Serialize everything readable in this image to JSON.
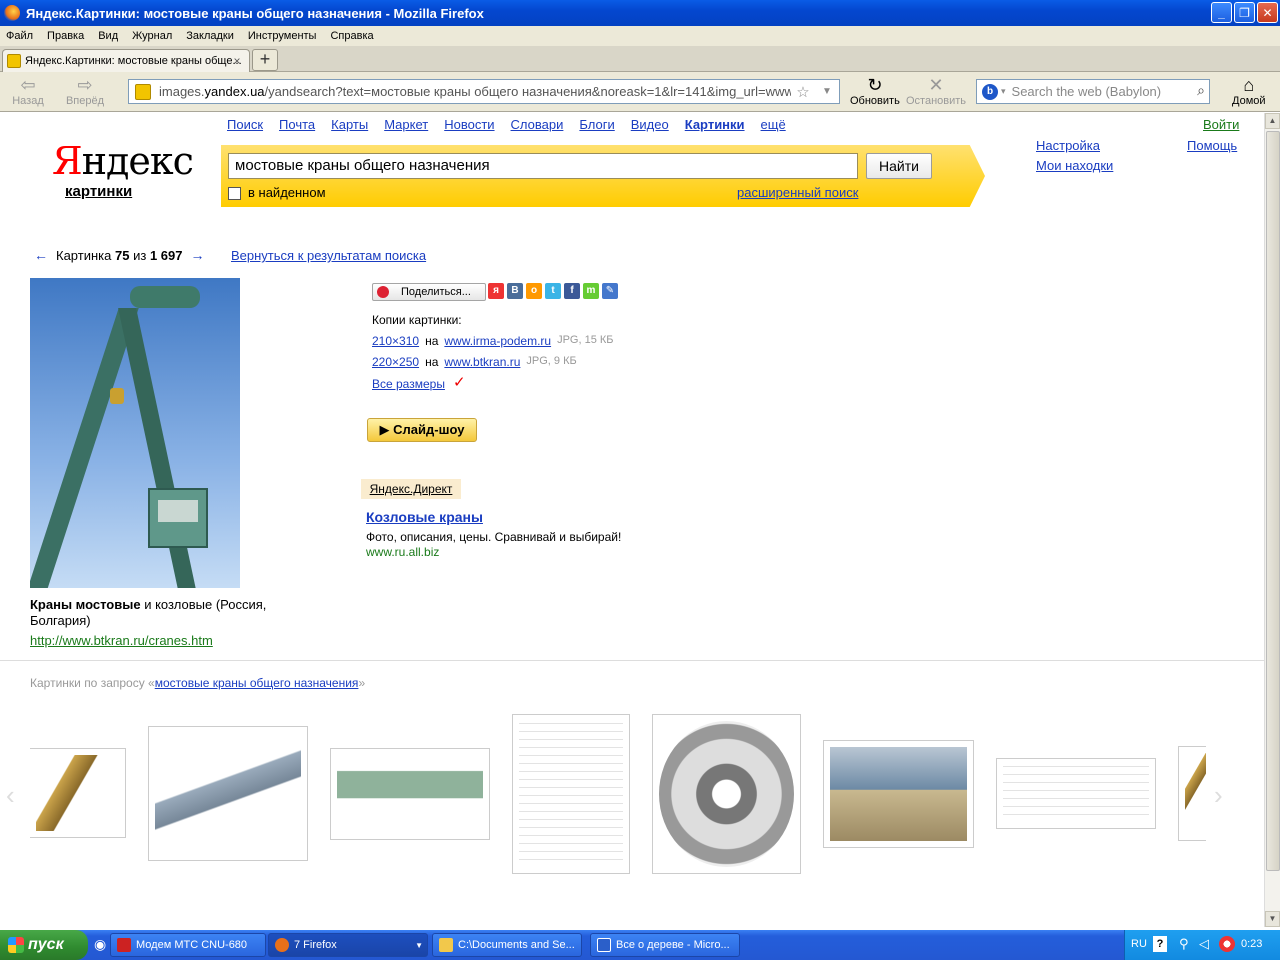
{
  "window": {
    "title": "Яндекс.Картинки: мостовые краны общего назначения - Mozilla Firefox",
    "buttons": [
      "_",
      "❐",
      "✕"
    ]
  },
  "menubar": [
    "Файл",
    "Правка",
    "Вид",
    "Журнал",
    "Закладки",
    "Инструменты",
    "Справка"
  ],
  "tab": {
    "title": "Яндекс.Картинки: мостовые краны обще...",
    "close": "×",
    "new_tab": "+"
  },
  "nav": {
    "back": "Назад",
    "forward": "Вперёд",
    "url_prefix": "images.",
    "url_host": "yandex.ua",
    "url_rest": "/yandsearch?text=мостовые краны общего назначения&noreask=1&lr=141&img_url=www",
    "reload": "Обновить",
    "stop": "Остановить",
    "search_placeholder": "Search the web (Babylon)",
    "home": "Домой"
  },
  "yandex": {
    "logo": "Яндекс",
    "logo_first": "Я",
    "logo_rest": "ндекс",
    "logo_sub": "картинки",
    "topnav": [
      "Поиск",
      "Почта",
      "Карты",
      "Маркет",
      "Новости",
      "Словари",
      "Блоги",
      "Видео",
      "Картинки",
      "ещё"
    ],
    "login": "Войти",
    "settings": "Настройка",
    "help": "Помощь",
    "my_finds": "Мои находки",
    "query": "мостовые краны общего назначения",
    "search_button": "Найти",
    "in_found": "в найденном",
    "advanced": "расширенный поиск"
  },
  "pager": {
    "prev": "←",
    "label": "Картинка",
    "current": "75",
    "of": "из",
    "total": "1 697",
    "next": "→",
    "back_to_results": "Вернуться к результатам поиска"
  },
  "image": {
    "caption_bold": "Краны мостовые",
    "caption_rest": " и козловые (Россия, Болгария)",
    "source_url": "http://www.btkran.ru/cranes.htm"
  },
  "share": {
    "label": "Поделиться...",
    "icons": [
      "я",
      "В",
      "о",
      "t",
      "f",
      "m",
      "✎"
    ]
  },
  "copies": {
    "label": "Копии картинки:",
    "on": "на",
    "rows": [
      {
        "size": "210×310",
        "site": "www.irma-podem.ru",
        "meta": "JPG, 15 КБ"
      },
      {
        "size": "220×250",
        "site": "www.btkran.ru",
        "meta": "JPG, 9 КБ"
      }
    ],
    "all_sizes": "Все размеры",
    "check": "✓"
  },
  "slideshow": "▶ Слайд-шоу",
  "ad": {
    "direct": "Яндекс.Директ",
    "title": "Козловые краны",
    "text": "Фото, описания, цены. Сравнивай и выбирай!",
    "url": "www.ru.all.biz"
  },
  "related": {
    "prefix": "Картинки по запросу «",
    "query": "мостовые краны общего назначения",
    "suffix": "»"
  },
  "carousel": {
    "left": "‹",
    "right": "›"
  },
  "taskbar": {
    "start": "пуск",
    "tasks": [
      {
        "label": "Модем МТС CNU-680"
      },
      {
        "label": "7 Firefox"
      },
      {
        "label": "C:\\Documents and Se..."
      },
      {
        "label": "Все о дереве - Micro..."
      }
    ],
    "lang": "RU",
    "help": "?",
    "clock": "0:23"
  },
  "colors": {
    "yandex_yellow": "#ffcc00",
    "link": "#1a3dc1",
    "green_url": "#1a7a1a",
    "xp_blue": "#245edb"
  }
}
